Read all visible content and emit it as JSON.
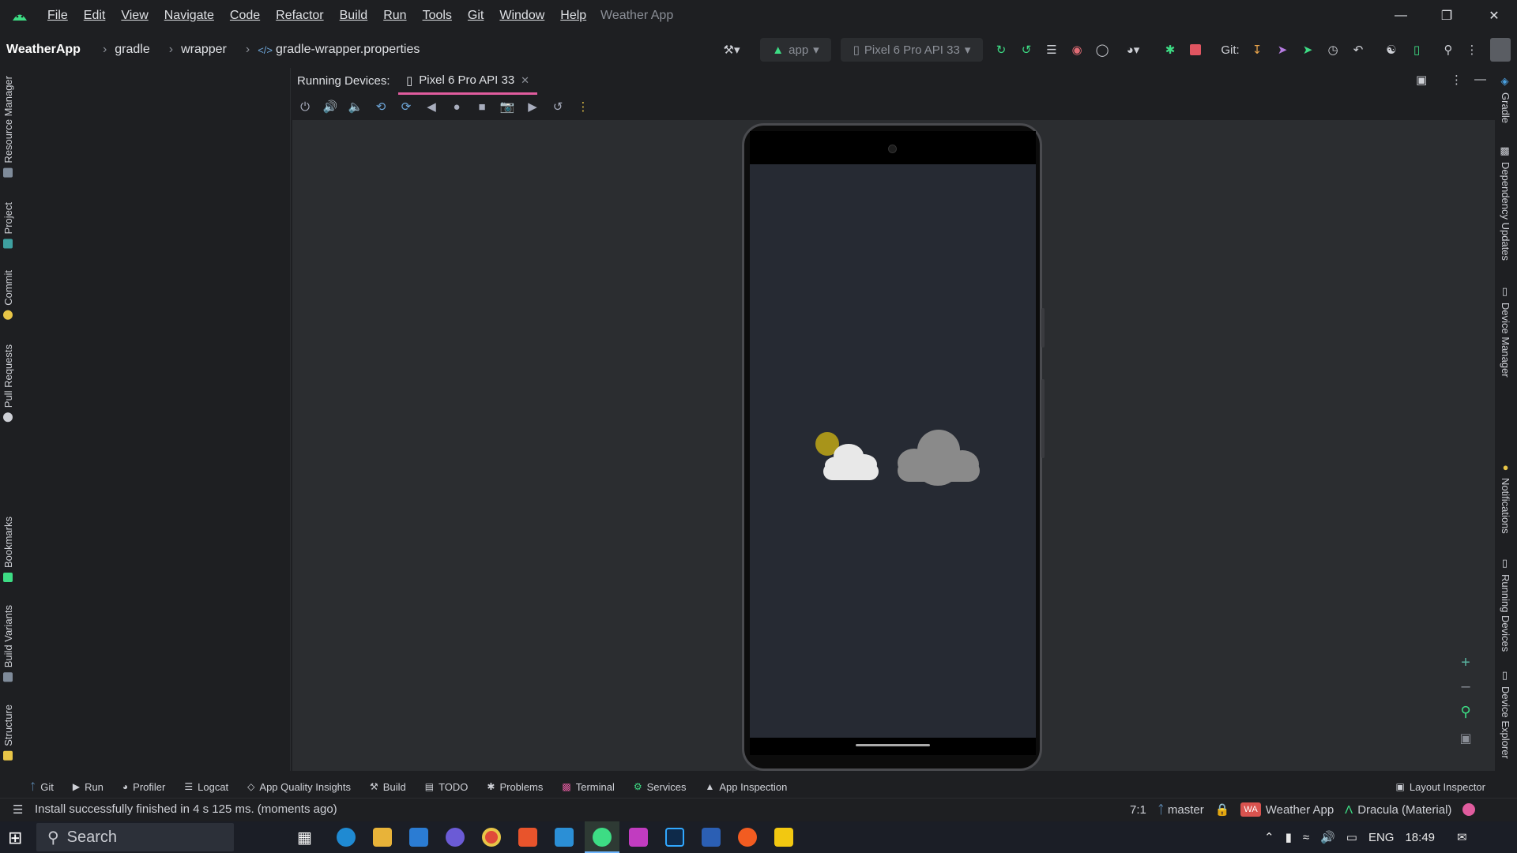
{
  "titlebar": {
    "menu": [
      "File",
      "Edit",
      "View",
      "Navigate",
      "Code",
      "Refactor",
      "Build",
      "Run",
      "Tools",
      "Git",
      "Window",
      "Help"
    ],
    "title": "Weather App"
  },
  "breadcrumbs": {
    "project": "WeatherApp",
    "items": [
      "gradle",
      "wrapper",
      "gradle-wrapper.properties"
    ]
  },
  "toolbar": {
    "run_config": "app",
    "device": "Pixel 6 Pro API 33",
    "git_label": "Git:"
  },
  "left_tools": [
    "Resource Manager",
    "Project",
    "Commit",
    "Pull Requests",
    "Bookmarks",
    "Build Variants",
    "Structure"
  ],
  "right_tools": [
    "Gradle",
    "Dependency Updates",
    "Device Manager",
    "Notifications",
    "Running Devices",
    "Device Explorer"
  ],
  "running_devices": {
    "label": "Running Devices:",
    "tab": "Pixel 6 Pro API 33"
  },
  "bottom_tabs": [
    "Git",
    "Run",
    "Profiler",
    "Logcat",
    "App Quality Insights",
    "Build",
    "TODO",
    "Problems",
    "Terminal",
    "Services",
    "App Inspection"
  ],
  "layout_inspector": "Layout Inspector",
  "status": {
    "message": "Install successfully finished in 4 s 125 ms. (moments ago)",
    "position": "7:1",
    "branch": "master",
    "project_badge": "WA",
    "project": "Weather App",
    "theme": "Dracula (Material)"
  },
  "taskbar": {
    "search": "Search",
    "lang": "ENG",
    "time": "18:49"
  },
  "colors": {
    "accent": "#e05c9e",
    "android_green": "#3ddc84"
  }
}
